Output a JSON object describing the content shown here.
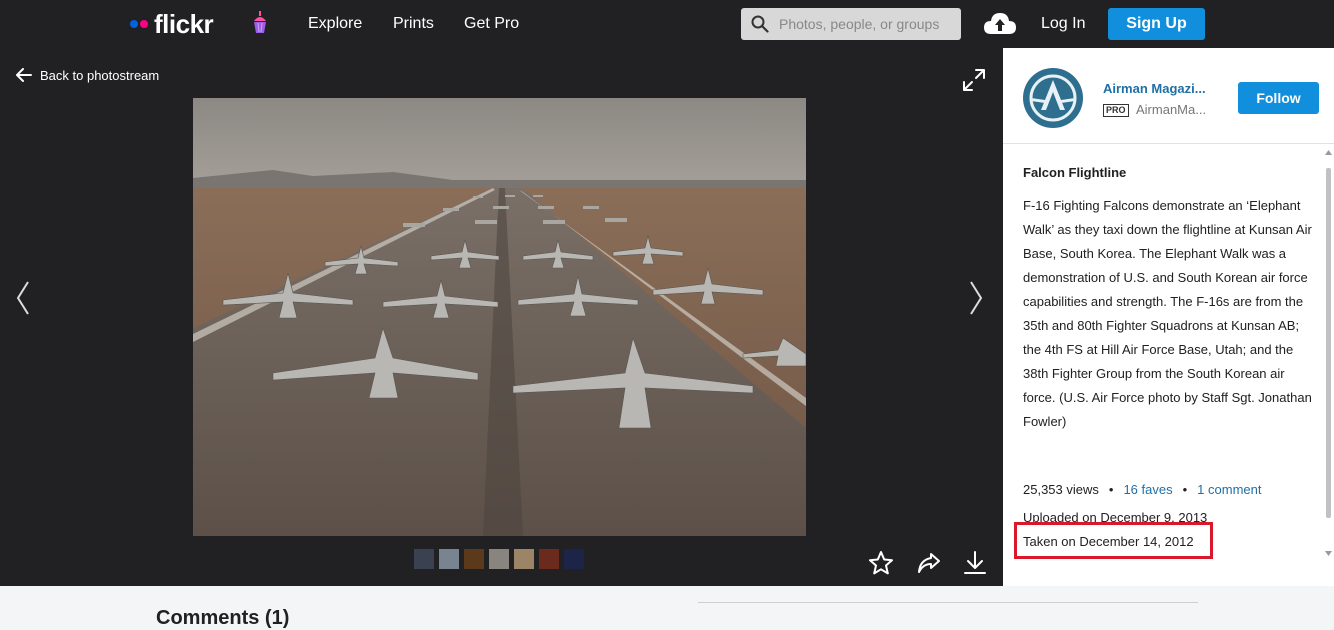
{
  "header": {
    "logo_text": "flickr",
    "nav": [
      "Explore",
      "Prints",
      "Get Pro"
    ],
    "search_placeholder": "Photos, people, or groups",
    "login_label": "Log In",
    "signup_label": "Sign Up"
  },
  "viewer": {
    "back_label": "Back to photostream"
  },
  "owner": {
    "name": "Airman Magazi...",
    "pro_badge": "PRO",
    "handle": "AirmanMa...",
    "follow_label": "Follow"
  },
  "photo": {
    "title": "Falcon Flightline",
    "description": "F-16 Fighting Falcons demonstrate an ‘Elephant Walk’ as they taxi down the flightline at Kunsan Air Base, South Korea. The Elephant Walk was a demonstration of U.S. and South Korean air force capabilities and strength. The F-16s are from the 35th and 80th Fighter Squadrons at Kunsan AB; the 4th FS at Hill Air Force Base, Utah; and the 38th Fighter Group from the South Korean air force. (U.S. Air Force photo by Staff Sgt. Jonathan Fowler)",
    "views": "25,353 views",
    "faves": "16 faves",
    "comments": "1 comment",
    "uploaded": "Uploaded on December 9, 2013",
    "taken": "Taken on December 14, 2012"
  },
  "comments_section": {
    "title": "Comments (1)"
  },
  "colors": {
    "nav_bg": "#212124",
    "accent_blue": "#128fdc",
    "link_blue": "#1f6fa6",
    "highlight_red": "#d9182b"
  }
}
